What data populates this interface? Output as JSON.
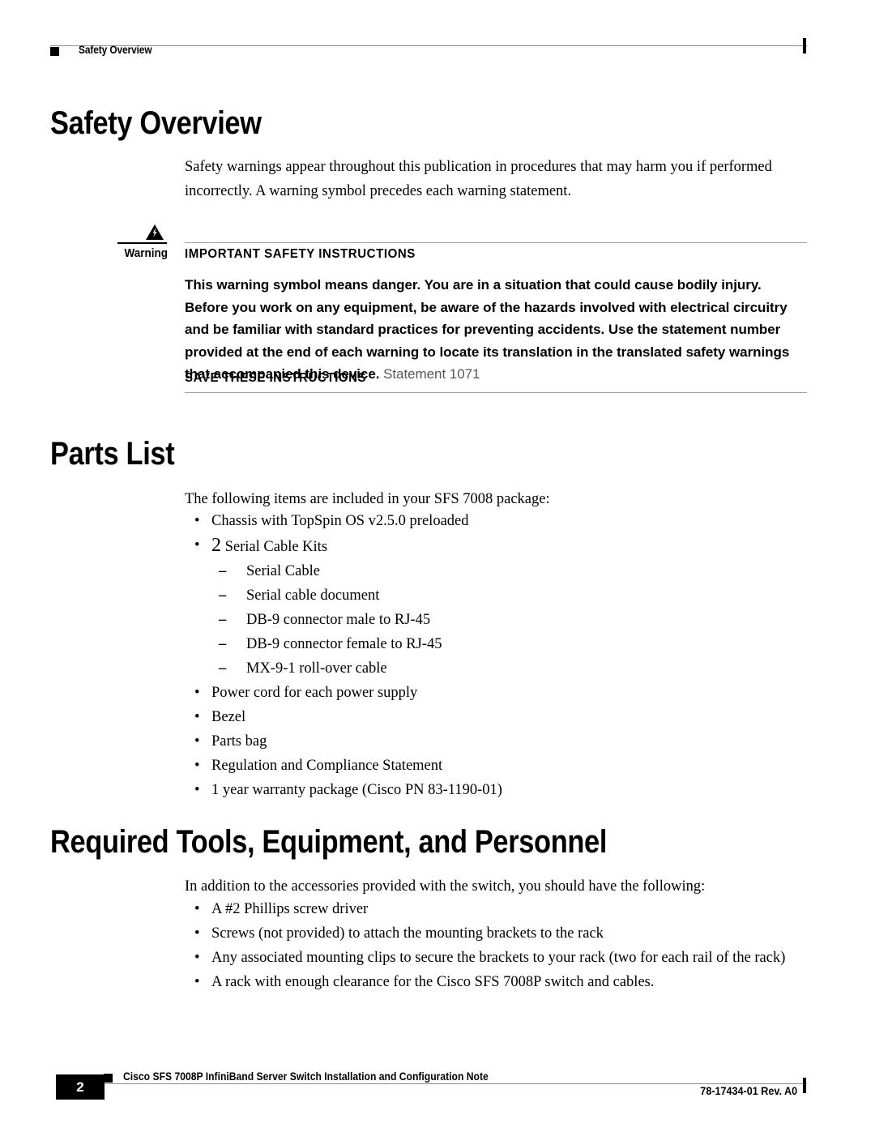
{
  "header": {
    "running_title": "Safety Overview",
    "marker_icon": "black-square-bullet",
    "end_tick_icon": "change-bar-tick"
  },
  "sections": {
    "safety": {
      "heading": "Safety Overview",
      "intro": "Safety warnings appear throughout this publication in procedures that may harm you if performed incorrectly. A warning symbol precedes each warning statement."
    },
    "parts": {
      "heading": "Parts List",
      "intro": "The following items are included in your SFS 7008 package:"
    },
    "required": {
      "heading": "Required Tools, Equipment, and Personnel",
      "intro": "In addition to the accessories provided with the switch, you should have the following:"
    }
  },
  "warning": {
    "label": "Warning",
    "icon": "warning-triangle-lightning-icon",
    "title": "IMPORTANT SAFETY INSTRUCTIONS",
    "body_bold": "This warning symbol means danger. You are in a situation that could cause bodily injury. Before you work on any equipment, be aware of the hazards involved with electrical circuitry and be familiar with standard practices for preventing accidents. Use the statement number provided at the end of each warning to locate its translation in the translated safety warnings that accompanied this device.",
    "statement": " Statement 1071",
    "save": "SAVE THESE INSTRUCTIONS"
  },
  "parts_list": [
    {
      "level": 1,
      "marker": "•",
      "text": "Chassis with TopSpin OS v2.5.0 preloaded"
    },
    {
      "level": 1,
      "marker": "•",
      "lead": "2",
      "text": " Serial Cable Kits"
    },
    {
      "level": 2,
      "marker": "–",
      "text": "Serial Cable"
    },
    {
      "level": 2,
      "marker": "–",
      "text": "Serial cable document"
    },
    {
      "level": 2,
      "marker": "–",
      "text": "DB-9 connector male to RJ-45"
    },
    {
      "level": 2,
      "marker": "–",
      "text": "DB-9 connector female to RJ-45"
    },
    {
      "level": 2,
      "marker": "–",
      "text": "MX-9-1 roll-over cable"
    },
    {
      "level": 1,
      "marker": "•",
      "text": "Power cord for each power supply"
    },
    {
      "level": 1,
      "marker": "•",
      "text": "Bezel"
    },
    {
      "level": 1,
      "marker": "•",
      "text": "Parts bag"
    },
    {
      "level": 1,
      "marker": "•",
      "text": "Regulation and Compliance Statement"
    },
    {
      "level": 1,
      "marker": "•",
      "text": "1 year warranty package (Cisco PN 83-1190-01)"
    }
  ],
  "required_list": [
    {
      "level": 1,
      "marker": "•",
      "text": "A #2 Phillips screw driver"
    },
    {
      "level": 1,
      "marker": "•",
      "text": "Screws (not provided) to attach the mounting brackets to the rack"
    },
    {
      "level": 1,
      "marker": "•",
      "text": "Any associated mounting clips to secure the brackets to your rack (two for each rail of the rack)"
    },
    {
      "level": 1,
      "marker": "•",
      "text": "A rack with enough clearance for the Cisco SFS 7008P switch and cables."
    }
  ],
  "footer": {
    "page_number": "2",
    "document_title": "Cisco SFS 7008P InfiniBand Server Switch Installation and Configuration Note",
    "document_number": "78-17434-01 Rev. A0",
    "marker_icon": "black-square-bullet",
    "end_tick_icon": "change-bar-tick"
  },
  "colors": {
    "ink": "#000000",
    "rule": "#8a8a8a",
    "warning_rule": "#a2a2a2",
    "statement_gray": "#565656",
    "paper": "#ffffff"
  }
}
